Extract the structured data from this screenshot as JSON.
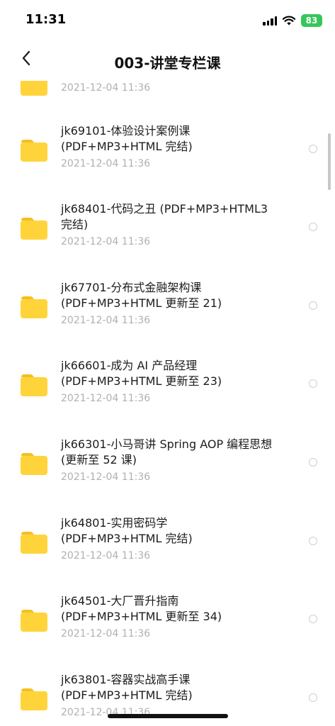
{
  "status_bar": {
    "time": "11:31",
    "battery": "83"
  },
  "nav": {
    "title": "003-讲堂专栏课",
    "back_icon": "chevron-left-icon"
  },
  "list": {
    "partial_item": {
      "date": "2021-12-04 11:36"
    },
    "items": [
      {
        "title": "jk69101-体验设计案例课\n(PDF+MP3+HTML 完结)",
        "date": "2021-12-04 11:36"
      },
      {
        "title": "jk68401-代码之丑 (PDF+MP3+HTML3\n完结)",
        "date": "2021-12-04 11:36"
      },
      {
        "title": "jk67701-分布式金融架构课\n(PDF+MP3+HTML 更新至 21)",
        "date": "2021-12-04 11:36"
      },
      {
        "title": "jk66601-成为 AI 产品经理\n(PDF+MP3+HTML 更新至 23)",
        "date": "2021-12-04 11:36"
      },
      {
        "title": "jk66301-小马哥讲 Spring AOP 编程思想\n(更新至 52 课)",
        "date": "2021-12-04 11:36"
      },
      {
        "title": "jk64801-实用密码学\n(PDF+MP3+HTML 完结)",
        "date": "2021-12-04 11:36"
      },
      {
        "title": "jk64501-大厂晋升指南\n(PDF+MP3+HTML 更新至 34)",
        "date": "2021-12-04 11:36"
      },
      {
        "title": "jk63801-容器实战高手课\n(PDF+MP3+HTML 完结)",
        "date": "2021-12-04 11:36"
      }
    ]
  },
  "colors": {
    "folder": "#FFD43B",
    "folder_tab": "#F5BF1F",
    "battery": "#36C759",
    "date_text": "#B0B0B0"
  }
}
